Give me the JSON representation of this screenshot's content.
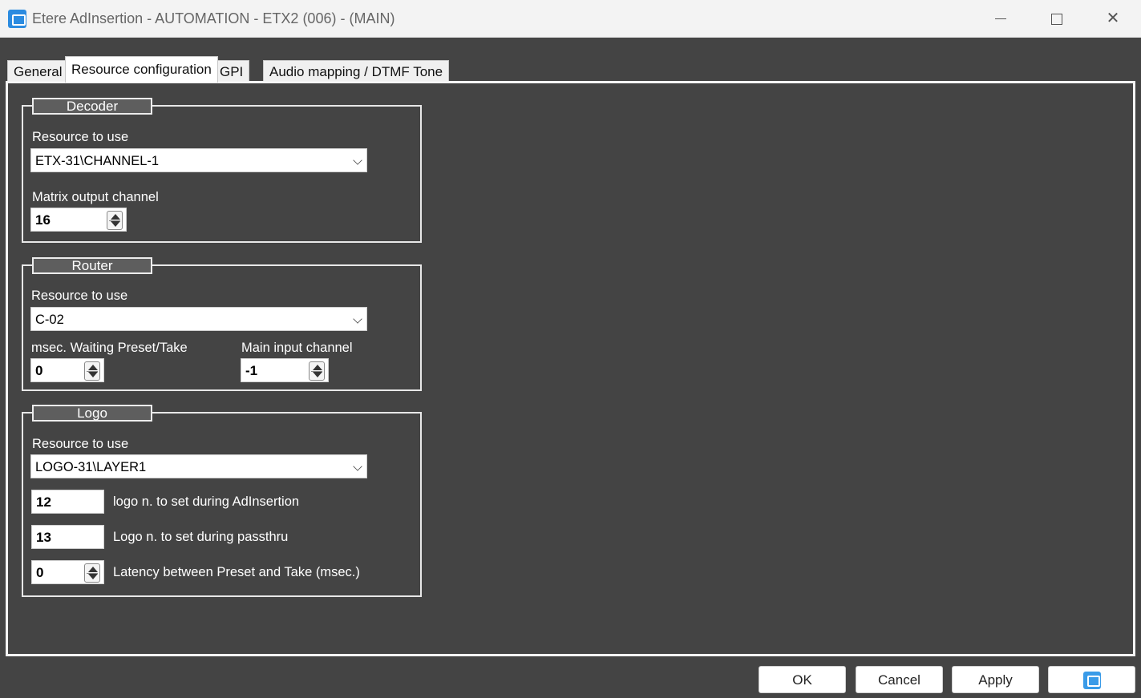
{
  "window": {
    "title": "Etere AdInsertion - AUTOMATION - ETX2 (006) - (MAIN)",
    "icon": "etere-app-icon",
    "controls": {
      "minimize": "minimize-icon",
      "maximize": "maximize-icon",
      "close": "✕"
    }
  },
  "tabs": [
    {
      "label": "General",
      "active": false
    },
    {
      "label": "Resource configuration",
      "active": true
    },
    {
      "label": "GPI",
      "active": false
    },
    {
      "label": "Audio mapping / DTMF Tone",
      "active": false
    }
  ],
  "decoder": {
    "title": "Decoder",
    "resource_label": "Resource to use",
    "resource_value": "ETX-31\\CHANNEL-1",
    "matrix_label": "Matrix output channel",
    "matrix_value": "16"
  },
  "router": {
    "title": "Router",
    "resource_label": "Resource to use",
    "resource_value": "C-02",
    "waiting_label": "msec. Waiting Preset/Take",
    "waiting_value": "0",
    "main_input_label": "Main input channel",
    "main_input_value": "-1"
  },
  "logo": {
    "title": "Logo",
    "resource_label": "Resource to use",
    "resource_value": "LOGO-31\\LAYER1",
    "adinsertion_value": "12",
    "adinsertion_label": "logo n. to set during AdInsertion",
    "passthru_value": "13",
    "passthru_label": "Logo n. to set during passthru",
    "latency_value": "0",
    "latency_label": "Latency between Preset and Take (msec.)"
  },
  "buttons": {
    "ok": "OK",
    "cancel": "Cancel",
    "apply": "Apply",
    "help_icon": "help-icon"
  },
  "colors": {
    "background": "#444444",
    "accent": "#2b8be0"
  }
}
